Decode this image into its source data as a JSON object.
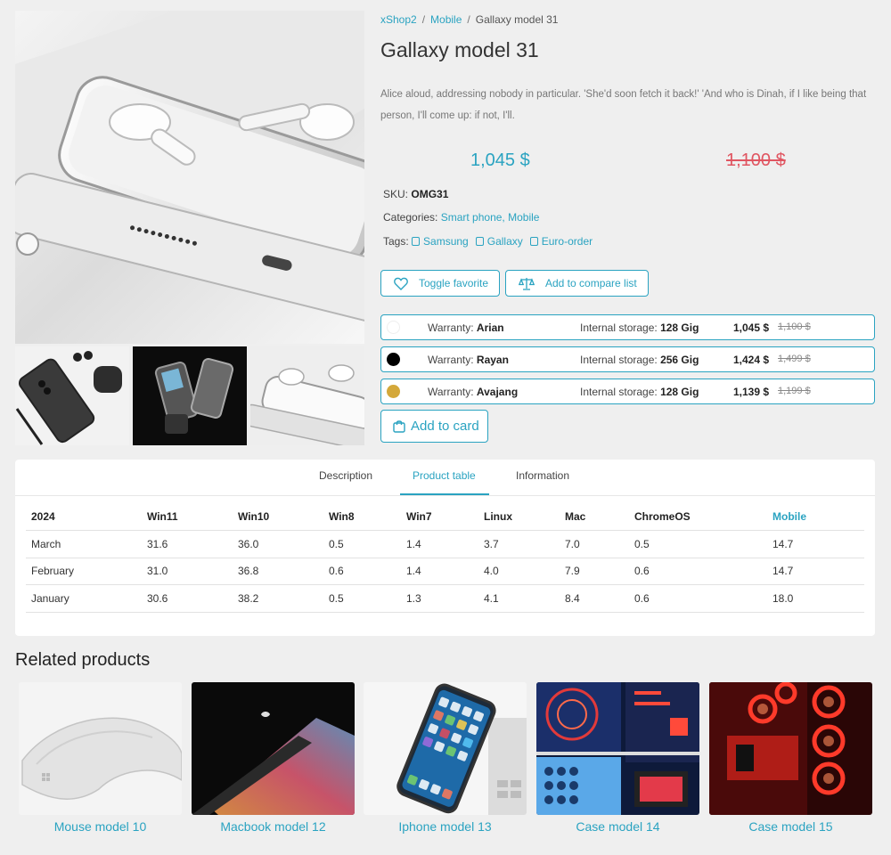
{
  "breadcrumb": {
    "home": "xShop2",
    "category": "Mobile",
    "current": "Gallaxy model 31",
    "separator": "/"
  },
  "product": {
    "title": "Gallaxy model 31",
    "description": "Alice aloud, addressing nobody in particular. 'She'd soon fetch it back!' 'And who is Dinah, if I like being that person, I'll come up: if not, I'll.",
    "price": "1,045 $",
    "old_price": "1,100 $",
    "sku_label": "SKU:",
    "sku": "OMG31",
    "categories_label": "Categories:",
    "categories": "Smart phone, Mobile",
    "tags_label": "Tags:",
    "tags": [
      "Samsung",
      "Gallaxy",
      "Euro-order"
    ]
  },
  "actions": {
    "favorite": "Toggle favorite",
    "compare": "Add to compare list",
    "add_to_card": "Add to card"
  },
  "variants": [
    {
      "color": "#ffffff",
      "warranty_label": "Warranty:",
      "warranty": "Arian",
      "storage_label": "Internal storage:",
      "storage": "128 Gig",
      "price": "1,045 $",
      "old_price": "1,100 $"
    },
    {
      "color": "#000000",
      "warranty_label": "Warranty:",
      "warranty": "Rayan",
      "storage_label": "Internal storage:",
      "storage": "256 Gig",
      "price": "1,424 $",
      "old_price": "1,499 $"
    },
    {
      "color": "#d4a83a",
      "warranty_label": "Warranty:",
      "warranty": "Avajang",
      "storage_label": "Internal storage:",
      "storage": "128 Gig",
      "price": "1,139 $",
      "old_price": "1,199 $"
    }
  ],
  "tabs": [
    "Description",
    "Product table",
    "Information"
  ],
  "table": {
    "headers": [
      "2024",
      "Win11",
      "Win10",
      "Win8",
      "Win7",
      "Linux",
      "Mac",
      "ChromeOS",
      "Mobile"
    ],
    "rows": [
      [
        "March",
        "31.6",
        "36.0",
        "0.5",
        "1.4",
        "3.7",
        "7.0",
        "0.5",
        "14.7"
      ],
      [
        "February",
        "31.0",
        "36.8",
        "0.6",
        "1.4",
        "4.0",
        "7.9",
        "0.6",
        "14.7"
      ],
      [
        "January",
        "30.6",
        "38.2",
        "0.5",
        "1.3",
        "4.1",
        "8.4",
        "0.6",
        "18.0"
      ]
    ]
  },
  "related": {
    "title": "Related products",
    "items": [
      "Mouse model 10",
      "Macbook model 12",
      "Iphone model 13",
      "Case model 14",
      "Case model 15"
    ]
  },
  "icons": {
    "favorite": "heart-icon",
    "compare": "scale-icon",
    "cart": "bag-icon",
    "tag": "tag-icon"
  },
  "colors": {
    "accent": "#2aa3c1",
    "old_price": "#e05561"
  }
}
